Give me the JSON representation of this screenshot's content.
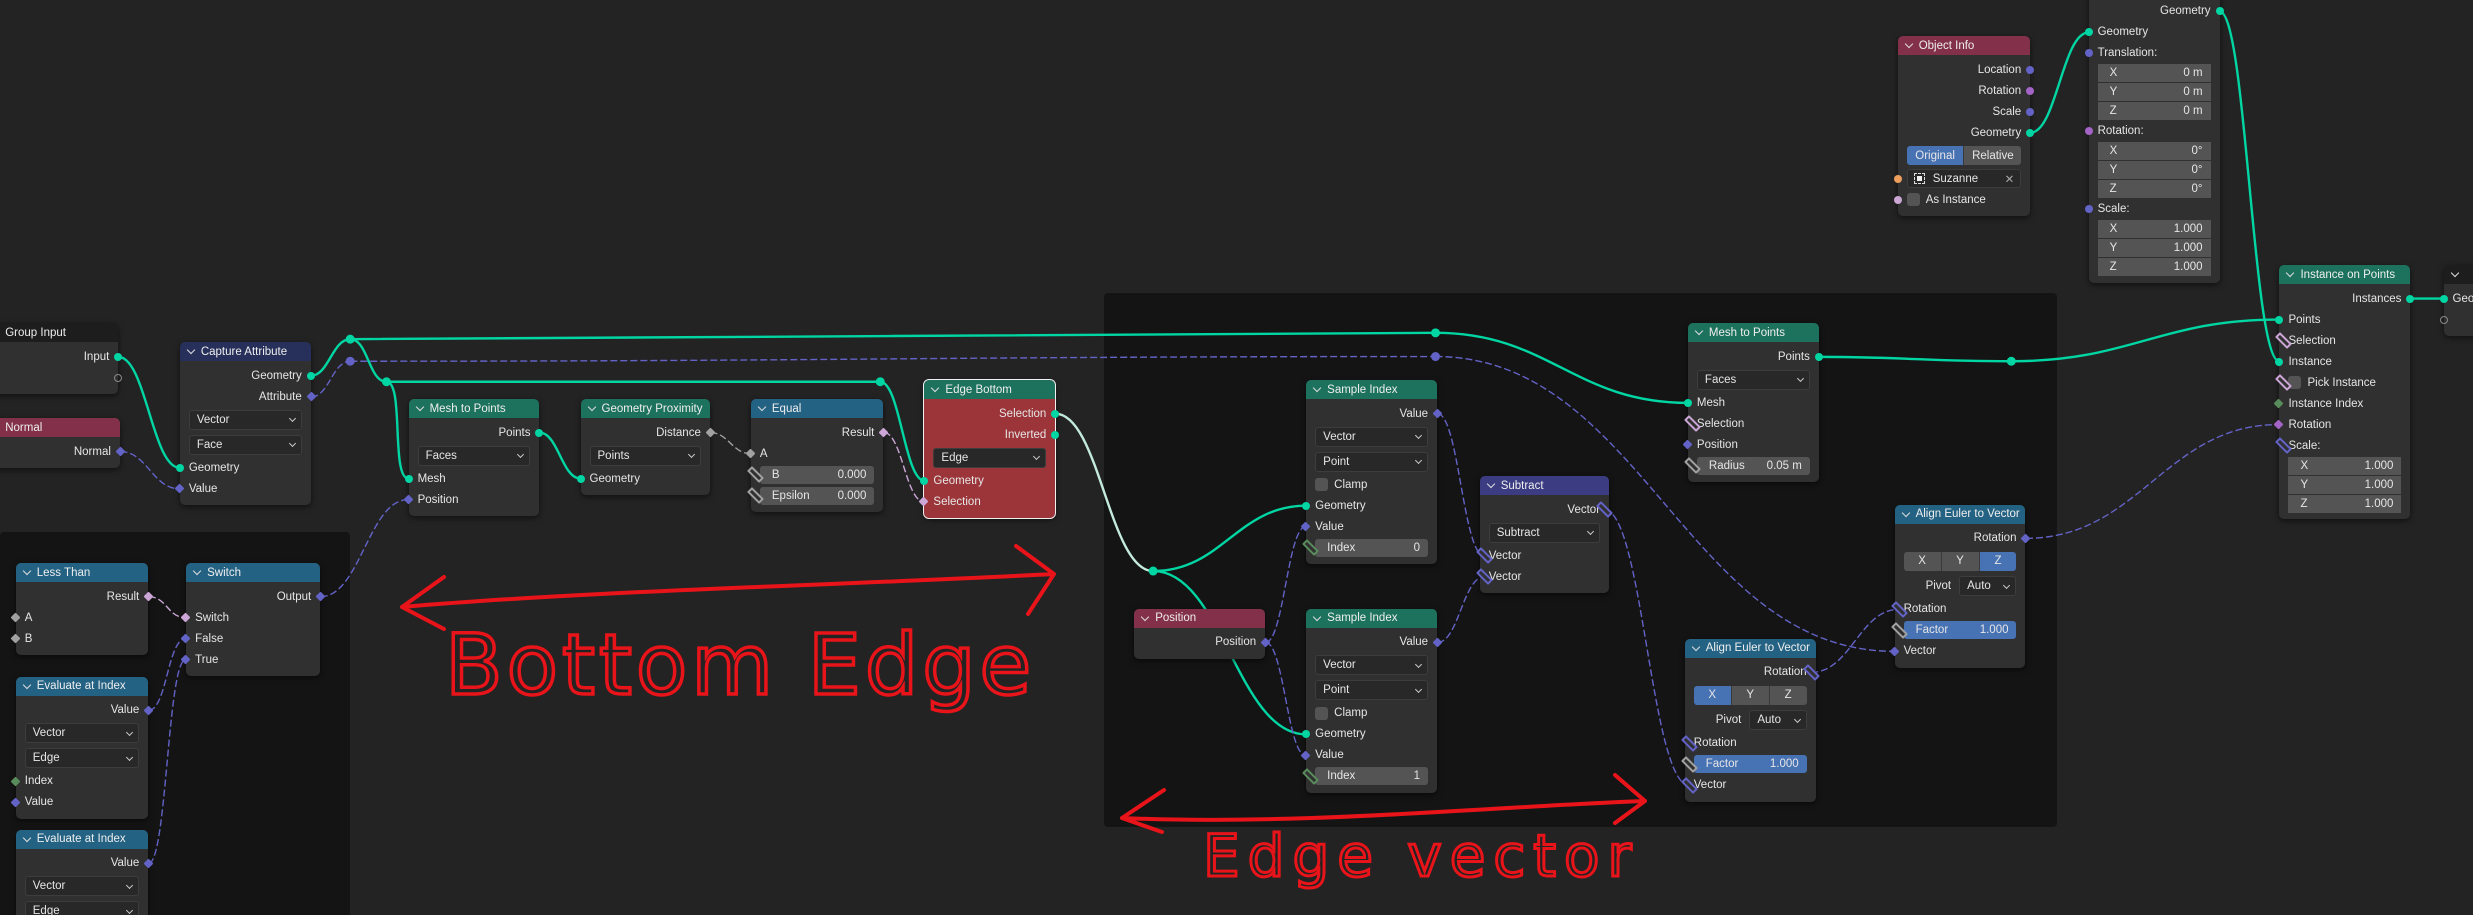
{
  "socket_colors": {
    "geo": "#00d6a3",
    "vec": "#6363c7",
    "float": "#a1a1a1",
    "bool": "#cca6d6",
    "int": "#598c5c",
    "rot": "#a363c7",
    "obj": "#ed9e5c",
    "empty": "#8a8a8a"
  },
  "header_colors": {
    "group": "#1d1d1d",
    "input": "#83314a",
    "attr": "#27305a",
    "geo": "#1d725e",
    "conv": "#246283",
    "vec": "#3c3c83"
  },
  "annotation_color": "#e8141a",
  "annotations": {
    "bottom_edge": "Bottom Edge",
    "edge_vector": "Edge vector"
  },
  "reroutes": [
    {
      "id": "r1",
      "s": "geo"
    },
    {
      "id": "r2",
      "s": "vec"
    },
    {
      "id": "r3",
      "s": "geo"
    },
    {
      "id": "r4",
      "s": "geo"
    },
    {
      "id": "r5",
      "s": "geo"
    },
    {
      "id": "r6",
      "s": "vec"
    },
    {
      "id": "r7",
      "s": "geo"
    },
    {
      "id": "r8",
      "s": "geo"
    }
  ],
  "nodes": [
    {
      "id": "group_input",
      "title": "Group Input",
      "hdr": "group",
      "rows": [
        {
          "t": "out",
          "l": "Input",
          "s": "geo",
          "k": "in"
        },
        {
          "t": "out",
          "l": "",
          "s": "empty",
          "sh": "h",
          "k": "e"
        }
      ]
    },
    {
      "id": "normal",
      "title": "Normal",
      "hdr": "input",
      "rows": [
        {
          "t": "out",
          "l": "Normal",
          "s": "vec",
          "sh": "d",
          "k": "n"
        }
      ]
    },
    {
      "id": "capture",
      "title": "Capture Attribute",
      "hdr": "attr",
      "rows": [
        {
          "t": "out",
          "l": "Geometry",
          "s": "geo",
          "k": "g"
        },
        {
          "t": "out",
          "l": "Attribute",
          "s": "vec",
          "sh": "d",
          "k": "a"
        },
        {
          "t": "dd",
          "v": "Vector"
        },
        {
          "t": "dd",
          "v": "Face"
        },
        {
          "t": "in",
          "l": "Geometry",
          "s": "geo",
          "k": "gin"
        },
        {
          "t": "in",
          "l": "Value",
          "s": "vec",
          "sh": "d",
          "k": "val"
        }
      ]
    },
    {
      "id": "mtp1",
      "title": "Mesh to Points",
      "hdr": "geo",
      "rows": [
        {
          "t": "out",
          "l": "Points",
          "s": "geo",
          "k": "pts"
        },
        {
          "t": "dd",
          "v": "Faces"
        },
        {
          "t": "in",
          "l": "Mesh",
          "s": "geo",
          "k": "mesh"
        },
        {
          "t": "in",
          "l": "Position",
          "s": "vec",
          "sh": "d",
          "k": "pos"
        }
      ]
    },
    {
      "id": "prox",
      "title": "Geometry Proximity",
      "hdr": "geo",
      "rows": [
        {
          "t": "out",
          "l": "Distance",
          "s": "float",
          "sh": "d",
          "k": "dist"
        },
        {
          "t": "dd",
          "v": "Points"
        },
        {
          "t": "in",
          "l": "Geometry",
          "s": "geo",
          "k": "geo"
        }
      ]
    },
    {
      "id": "equal",
      "title": "Equal",
      "hdr": "conv",
      "rows": [
        {
          "t": "out",
          "l": "Result",
          "s": "bool",
          "sh": "d",
          "k": "res"
        },
        {
          "t": "in",
          "l": "A",
          "s": "float",
          "sh": "d",
          "k": "a"
        },
        {
          "t": "field",
          "l": "B",
          "v": "0.000",
          "s": "float",
          "sh": "dd",
          "k": "b"
        },
        {
          "t": "field",
          "l": "Epsilon",
          "v": "0.000",
          "s": "float",
          "sh": "dd",
          "k": "eps"
        }
      ]
    },
    {
      "id": "edge_bottom",
      "title": "Edge Bottom",
      "hdr": "geo",
      "body": "#9c3539",
      "sel": true,
      "rows": [
        {
          "t": "out",
          "l": "Selection",
          "s": "geo",
          "k": "sel"
        },
        {
          "t": "out",
          "l": "Inverted",
          "s": "geo",
          "k": "inv"
        },
        {
          "t": "dd",
          "v": "Edge"
        },
        {
          "t": "in",
          "l": "Geometry",
          "s": "geo",
          "k": "geo"
        },
        {
          "t": "in",
          "l": "Selection",
          "s": "bool",
          "sh": "d",
          "k": "selin"
        }
      ]
    },
    {
      "id": "less",
      "title": "Less Than",
      "hdr": "conv",
      "rows": [
        {
          "t": "out",
          "l": "Result",
          "s": "bool",
          "sh": "d",
          "k": "res"
        },
        {
          "t": "in",
          "l": "A",
          "s": "float",
          "sh": "d",
          "k": "a"
        },
        {
          "t": "in",
          "l": "B",
          "s": "float",
          "sh": "d",
          "k": "b"
        }
      ]
    },
    {
      "id": "switch",
      "title": "Switch",
      "hdr": "conv",
      "rows": [
        {
          "t": "out",
          "l": "Output",
          "s": "vec",
          "sh": "d",
          "k": "out"
        },
        {
          "t": "in",
          "l": "Switch",
          "s": "bool",
          "sh": "d",
          "k": "sw"
        },
        {
          "t": "in",
          "l": "False",
          "s": "vec",
          "sh": "d",
          "k": "f"
        },
        {
          "t": "in",
          "l": "True",
          "s": "vec",
          "sh": "d",
          "k": "tr"
        }
      ]
    },
    {
      "id": "eval1",
      "title": "Evaluate at Index",
      "hdr": "conv",
      "rows": [
        {
          "t": "out",
          "l": "Value",
          "s": "vec",
          "sh": "d",
          "k": "val"
        },
        {
          "t": "dd",
          "v": "Vector"
        },
        {
          "t": "dd",
          "v": "Edge"
        },
        {
          "t": "in",
          "l": "Index",
          "s": "int",
          "sh": "d",
          "k": "idx"
        },
        {
          "t": "in",
          "l": "Value",
          "s": "vec",
          "sh": "d",
          "k": "vin"
        }
      ]
    },
    {
      "id": "eval2",
      "title": "Evaluate at Index",
      "hdr": "conv",
      "rows": [
        {
          "t": "out",
          "l": "Value",
          "s": "vec",
          "sh": "d",
          "k": "val"
        },
        {
          "t": "dd",
          "v": "Vector"
        },
        {
          "t": "dd",
          "v": "Edge"
        }
      ]
    },
    {
      "id": "position",
      "title": "Position",
      "hdr": "input",
      "rows": [
        {
          "t": "out",
          "l": "Position",
          "s": "vec",
          "sh": "d",
          "k": "pos"
        }
      ]
    },
    {
      "id": "si1",
      "title": "Sample Index",
      "hdr": "geo",
      "rows": [
        {
          "t": "out",
          "l": "Value",
          "s": "vec",
          "sh": "d",
          "k": "val"
        },
        {
          "t": "dd",
          "v": "Vector"
        },
        {
          "t": "dd",
          "v": "Point"
        },
        {
          "t": "check",
          "l": "Clamp"
        },
        {
          "t": "in",
          "l": "Geometry",
          "s": "geo",
          "k": "geo"
        },
        {
          "t": "in",
          "l": "Value",
          "s": "vec",
          "sh": "d",
          "k": "vin"
        },
        {
          "t": "field",
          "l": "Index",
          "v": "0",
          "s": "int",
          "sh": "dd",
          "k": "idx"
        }
      ]
    },
    {
      "id": "si2",
      "title": "Sample Index",
      "hdr": "geo",
      "rows": [
        {
          "t": "out",
          "l": "Value",
          "s": "vec",
          "sh": "d",
          "k": "val"
        },
        {
          "t": "dd",
          "v": "Vector"
        },
        {
          "t": "dd",
          "v": "Point"
        },
        {
          "t": "check",
          "l": "Clamp"
        },
        {
          "t": "in",
          "l": "Geometry",
          "s": "geo",
          "k": "geo"
        },
        {
          "t": "in",
          "l": "Value",
          "s": "vec",
          "sh": "d",
          "k": "vin"
        },
        {
          "t": "field",
          "l": "Index",
          "v": "1",
          "s": "int",
          "sh": "dd",
          "k": "idx"
        }
      ]
    },
    {
      "id": "subtract",
      "title": "Subtract",
      "hdr": "vec",
      "rows": [
        {
          "t": "out",
          "l": "Vector",
          "s": "vec",
          "sh": "dd",
          "k": "vec"
        },
        {
          "t": "dd",
          "v": "Subtract"
        },
        {
          "t": "in",
          "l": "Vector",
          "s": "vec",
          "sh": "dd",
          "k": "v1"
        },
        {
          "t": "in",
          "l": "Vector",
          "s": "vec",
          "sh": "dd",
          "k": "v2"
        }
      ]
    },
    {
      "id": "mtp2",
      "title": "Mesh to Points",
      "hdr": "geo",
      "rows": [
        {
          "t": "out",
          "l": "Points",
          "s": "geo",
          "k": "pts"
        },
        {
          "t": "dd",
          "v": "Faces"
        },
        {
          "t": "in",
          "l": "Mesh",
          "s": "geo",
          "k": "mesh"
        },
        {
          "t": "in",
          "l": "Selection",
          "s": "bool",
          "sh": "dd",
          "k": "sel"
        },
        {
          "t": "in",
          "l": "Position",
          "s": "vec",
          "sh": "d",
          "k": "pos"
        },
        {
          "t": "field",
          "l": "Radius",
          "v": "0.05 m",
          "s": "float",
          "sh": "dd",
          "k": "rad"
        }
      ]
    },
    {
      "id": "ae1",
      "title": "Align Euler to Vector",
      "hdr": "conv",
      "rows": [
        {
          "t": "out",
          "l": "Rotation",
          "s": "vec",
          "sh": "dd",
          "k": "rot"
        },
        {
          "t": "xyz",
          "opts": [
            "X",
            "Y",
            "Z"
          ],
          "active": 0
        },
        {
          "t": "pivot",
          "l": "Pivot",
          "v": "Auto"
        },
        {
          "t": "in",
          "l": "Rotation",
          "s": "vec",
          "sh": "dd",
          "k": "rin"
        },
        {
          "t": "field",
          "l": "Factor",
          "v": "1.000",
          "blue": true,
          "s": "float",
          "sh": "dd",
          "k": "fac"
        },
        {
          "t": "in",
          "l": "Vector",
          "s": "vec",
          "sh": "dd",
          "k": "vec"
        }
      ]
    },
    {
      "id": "ae2",
      "title": "Align Euler to Vector",
      "hdr": "conv",
      "rows": [
        {
          "t": "out",
          "l": "Rotation",
          "s": "vec",
          "sh": "d",
          "k": "rot"
        },
        {
          "t": "xyz",
          "opts": [
            "X",
            "Y",
            "Z"
          ],
          "active": 2
        },
        {
          "t": "pivot",
          "l": "Pivot",
          "v": "Auto"
        },
        {
          "t": "in",
          "l": "Rotation",
          "s": "vec",
          "sh": "dd",
          "k": "rin"
        },
        {
          "t": "field",
          "l": "Factor",
          "v": "1.000",
          "blue": true,
          "s": "float",
          "sh": "dd",
          "k": "fac"
        },
        {
          "t": "in",
          "l": "Vector",
          "s": "vec",
          "sh": "d",
          "k": "vec"
        }
      ]
    },
    {
      "id": "objinfo",
      "title": "Object Info",
      "hdr": "input",
      "rows": [
        {
          "t": "out",
          "l": "Location",
          "s": "vec",
          "k": "loc"
        },
        {
          "t": "out",
          "l": "Rotation",
          "s": "rot",
          "k": "rot"
        },
        {
          "t": "out",
          "l": "Scale",
          "s": "vec",
          "k": "scl"
        },
        {
          "t": "out",
          "l": "Geometry",
          "s": "geo",
          "k": "geo"
        },
        {
          "t": "toggle",
          "opts": [
            "Original",
            "Relative"
          ],
          "active": 0
        },
        {
          "t": "obj",
          "v": "Suzanne",
          "s": "obj",
          "k": "obj"
        },
        {
          "t": "check",
          "l": "As Instance",
          "s": "bool",
          "k": "asi"
        }
      ]
    },
    {
      "id": "transform",
      "title": "",
      "hdr": "geo",
      "rows": [
        {
          "t": "out",
          "l": "Geometry",
          "s": "geo",
          "k": "gout"
        },
        {
          "t": "in",
          "l": "Geometry",
          "s": "geo",
          "k": "gin"
        },
        {
          "t": "in",
          "l": "Translation:",
          "s": "vec",
          "k": "tr"
        },
        {
          "t": "vfield",
          "l": "X",
          "v": "0 m"
        },
        {
          "t": "vfield",
          "l": "Y",
          "v": "0 m"
        },
        {
          "t": "vfield",
          "l": "Z",
          "v": "0 m"
        },
        {
          "t": "in",
          "l": "Rotation:",
          "s": "rot",
          "k": "rot"
        },
        {
          "t": "vfield",
          "l": "X",
          "v": "0°"
        },
        {
          "t": "vfield",
          "l": "Y",
          "v": "0°"
        },
        {
          "t": "vfield",
          "l": "Z",
          "v": "0°"
        },
        {
          "t": "in",
          "l": "Scale:",
          "s": "vec",
          "k": "scl"
        },
        {
          "t": "vfield",
          "l": "X",
          "v": "1.000"
        },
        {
          "t": "vfield",
          "l": "Y",
          "v": "1.000"
        },
        {
          "t": "vfield",
          "l": "Z",
          "v": "1.000"
        }
      ]
    },
    {
      "id": "iop",
      "title": "Instance on Points",
      "hdr": "geo",
      "rows": [
        {
          "t": "out",
          "l": "Instances",
          "s": "geo",
          "k": "inst"
        },
        {
          "t": "in",
          "l": "Points",
          "s": "geo",
          "k": "pts"
        },
        {
          "t": "in",
          "l": "Selection",
          "s": "bool",
          "sh": "dd",
          "k": "sel"
        },
        {
          "t": "in",
          "l": "Instance",
          "s": "geo",
          "k": "instin"
        },
        {
          "t": "check",
          "l": "Pick Instance",
          "s": "bool",
          "sh": "dd",
          "k": "pick"
        },
        {
          "t": "in",
          "l": "Instance Index",
          "s": "int",
          "sh": "d",
          "k": "ii"
        },
        {
          "t": "in",
          "l": "Rotation",
          "s": "rot",
          "sh": "d",
          "k": "rot"
        },
        {
          "t": "in",
          "l": "Scale:",
          "s": "vec",
          "sh": "dd",
          "k": "scl"
        },
        {
          "t": "vfield",
          "l": "X",
          "v": "1.000"
        },
        {
          "t": "vfield",
          "l": "Y",
          "v": "1.000"
        },
        {
          "t": "vfield",
          "l": "Z",
          "v": "1.000"
        }
      ]
    },
    {
      "id": "output",
      "title": "",
      "hdr": "group",
      "rows": [
        {
          "t": "in",
          "l": "Geometry",
          "s": "geo",
          "k": "geo"
        },
        {
          "t": "in",
          "l": "",
          "s": "empty",
          "sh": "h",
          "k": "e"
        }
      ]
    }
  ],
  "links": [
    [
      "group_input.in",
      "capture.gin"
    ],
    [
      "normal.n",
      "capture.val"
    ],
    [
      "capture.g",
      "r1"
    ],
    [
      "capture.a",
      "r2"
    ],
    [
      "r1",
      "r3"
    ],
    [
      "r3",
      "mtp1.mesh"
    ],
    [
      "r3",
      "r4"
    ],
    [
      "r4",
      "edge_bottom.geo"
    ],
    [
      "r1",
      "r5"
    ],
    [
      "r2",
      "r6"
    ],
    [
      "r5",
      "mtp2.mesh"
    ],
    [
      "r6",
      "ae2.vec"
    ],
    [
      "mtp1.pts",
      "prox.geo"
    ],
    [
      "prox.dist",
      "equal.a"
    ],
    [
      "equal.res",
      "edge_bottom.selin"
    ],
    [
      "switch.out",
      "mtp1.pos"
    ],
    [
      "less.res",
      "switch.sw"
    ],
    [
      "eval1.val",
      "switch.f"
    ],
    [
      "eval2.val",
      "switch.tr"
    ],
    [
      "edge_bottom.sel",
      "r7"
    ],
    [
      "r7",
      "si1.geo"
    ],
    [
      "r7",
      "si2.geo"
    ],
    [
      "position.pos",
      "si1.vin"
    ],
    [
      "position.pos",
      "si2.vin"
    ],
    [
      "si1.val",
      "subtract.v1"
    ],
    [
      "si2.val",
      "subtract.v2"
    ],
    [
      "subtract.vec",
      "ae1.vec"
    ],
    [
      "ae1.rot",
      "ae2.rin"
    ],
    [
      "ae2.rot",
      "iop.rot"
    ],
    [
      "mtp2.pts",
      "r8"
    ],
    [
      "r8",
      "iop.pts"
    ],
    [
      "objinfo.geo",
      "transform.gin"
    ],
    [
      "transform.gout",
      "iop.instin"
    ],
    [
      "iop.inst",
      "output.geo"
    ]
  ]
}
